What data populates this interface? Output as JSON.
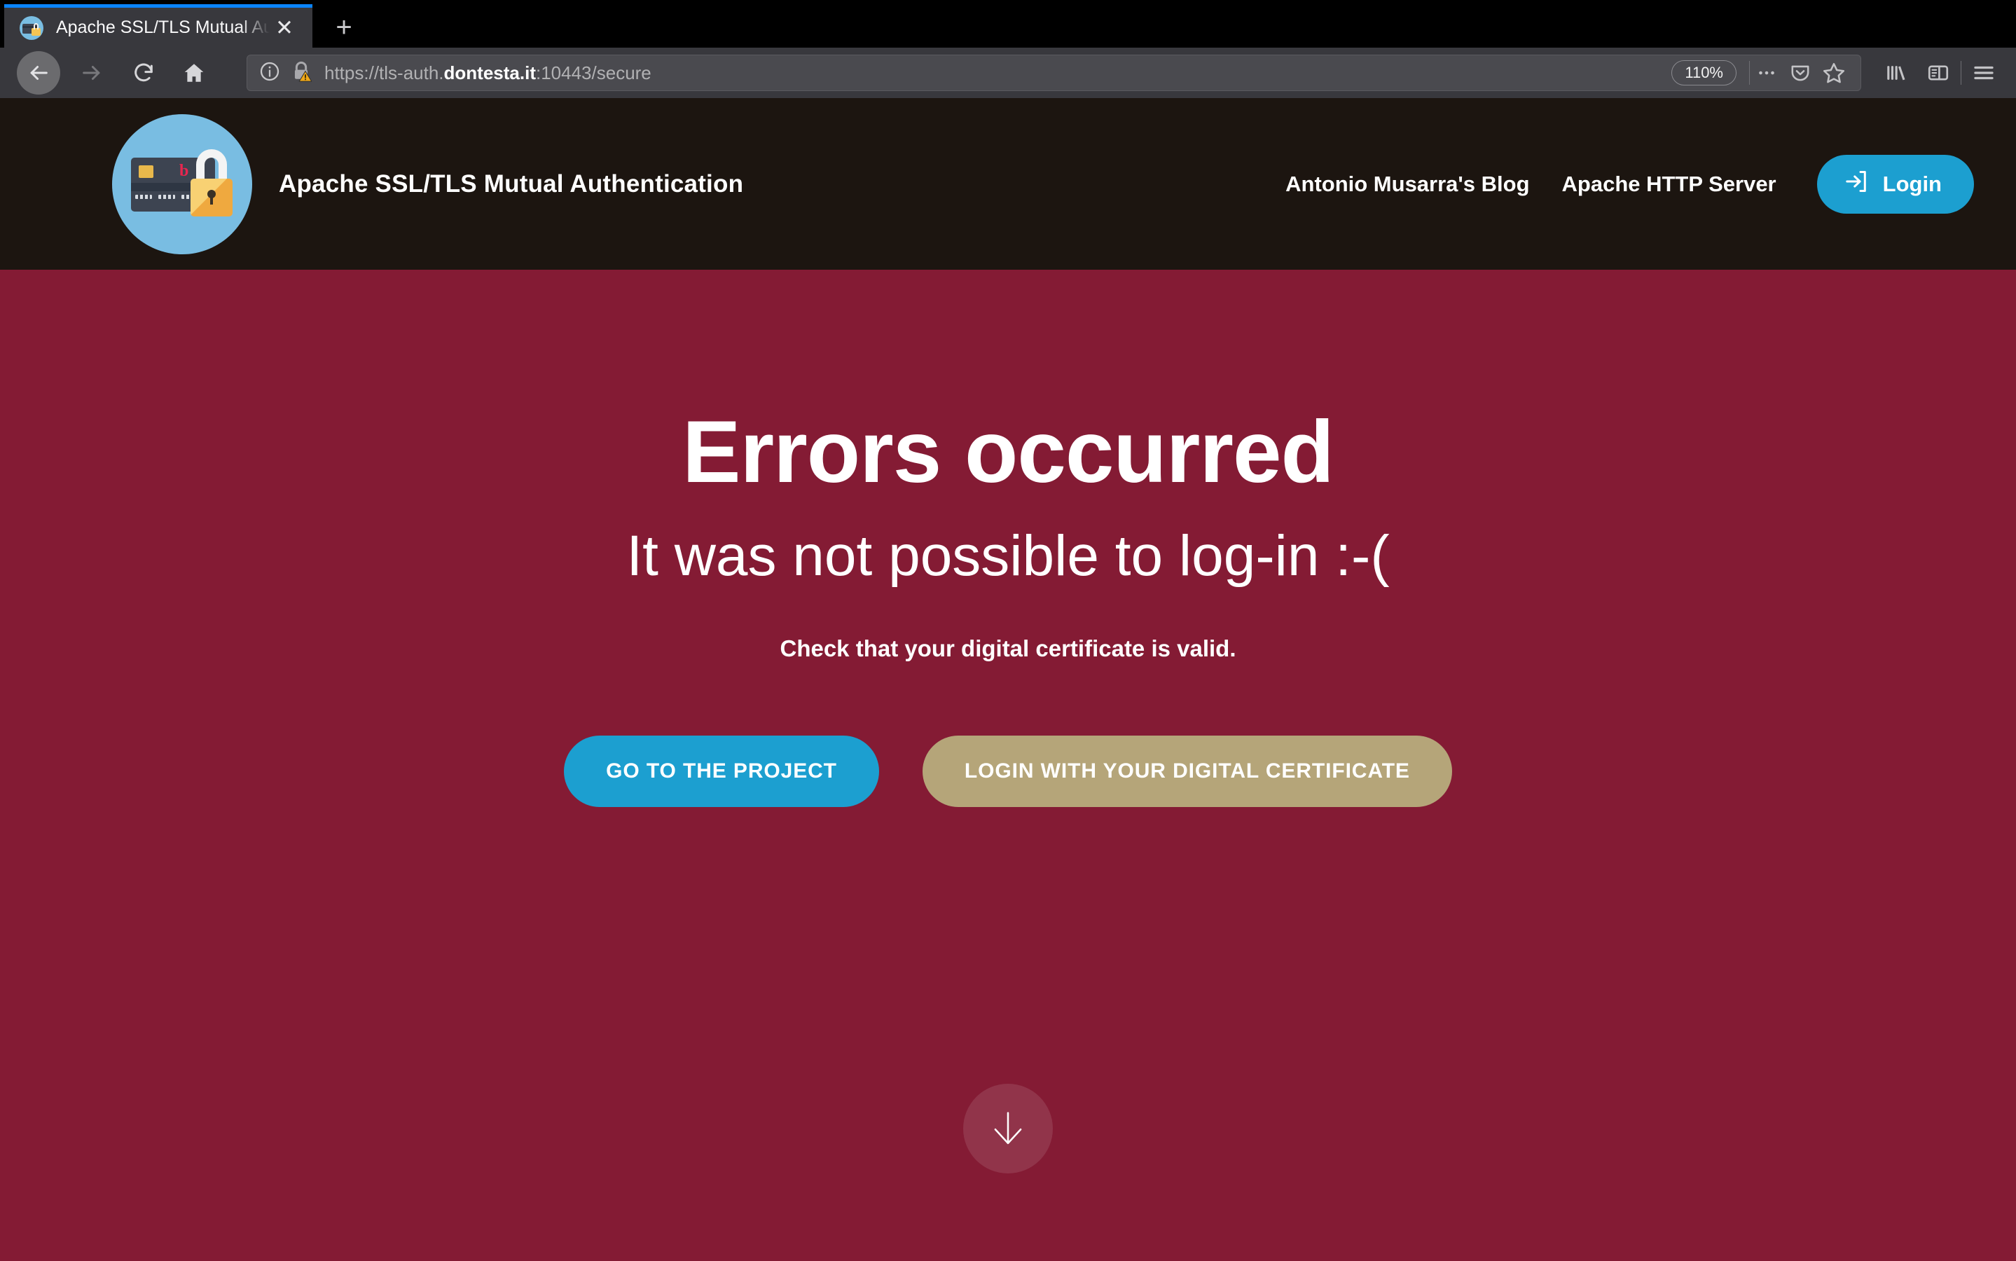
{
  "browser": {
    "tab": {
      "title": "Apache SSL/TLS Mutual Authen",
      "favicon_name": "credit-card-lock-favicon",
      "close_label": "✕"
    },
    "new_tab_label": "+",
    "nav": {
      "back_label": "Back",
      "forward_label": "Forward",
      "reload_label": "Reload",
      "home_label": "Home"
    },
    "urlbar": {
      "scheme": "https://tls-auth.",
      "host": "dontesta.it",
      "path": ":10443/secure",
      "full_url": "https://tls-auth.dontesta.it:10443/secure",
      "identity_icons": [
        "info-icon",
        "insecure-lock-warning-icon"
      ],
      "zoom_level": "110%",
      "page_actions_label": "•••",
      "pocket_label": "Save to Pocket",
      "bookmark_label": "Bookmark this page"
    },
    "toolbar_right": {
      "library_label": "Library",
      "sidebar_label": "Sidebars",
      "menu_label": "Open menu"
    }
  },
  "site": {
    "brand_title": "Apache SSL/TLS Mutual Authentication",
    "logo_name": "credit-card-padlock-logo",
    "nav_links": [
      {
        "label": "Antonio Musarra's Blog"
      },
      {
        "label": "Apache HTTP Server"
      }
    ],
    "login_button": {
      "label": "Login",
      "icon": "sign-in-icon"
    }
  },
  "hero": {
    "heading": "Errors occurred",
    "subheading": "It was not possible to log-in :-(",
    "lead": "Check that your digital certificate is valid.",
    "buttons": [
      {
        "label": "GO TO THE PROJECT",
        "style": "primary"
      },
      {
        "label": "LOGIN WITH YOUR DIGITAL CERTIFICATE",
        "style": "secondary"
      }
    ],
    "scroll_down_label": "Scroll down"
  },
  "colors": {
    "page_background": "#841B34",
    "header_background": "#1C1510",
    "accent_cyan": "#1C9FD0",
    "accent_tan": "#B5A579",
    "logo_blue": "#79BDE2",
    "tab_accent": "#0A84FF"
  }
}
